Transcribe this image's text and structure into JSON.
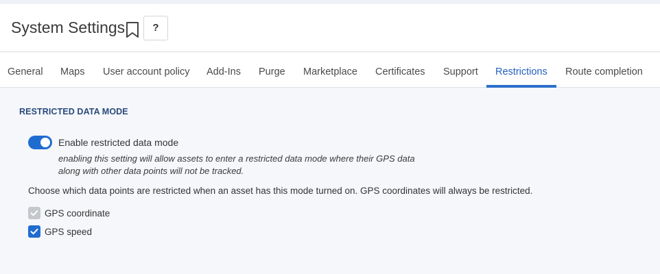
{
  "page": {
    "title": "System Settings",
    "help_label": "?"
  },
  "tabs": [
    {
      "label": "General",
      "active": false
    },
    {
      "label": "Maps",
      "active": false
    },
    {
      "label": "User account policy",
      "active": false
    },
    {
      "label": "Add-Ins",
      "active": false
    },
    {
      "label": "Purge",
      "active": false
    },
    {
      "label": "Marketplace",
      "active": false
    },
    {
      "label": "Certificates",
      "active": false
    },
    {
      "label": "Support",
      "active": false
    },
    {
      "label": "Restrictions",
      "active": true
    },
    {
      "label": "Route completion",
      "active": false
    }
  ],
  "section": {
    "title": "RESTRICTED DATA MODE",
    "toggle": {
      "label": "Enable restricted data mode",
      "on": true
    },
    "description": "enabling this setting will allow assets to enter a restricted data mode where their GPS data along with other data points will not be tracked.",
    "choose_text": "Choose which data points are restricted when an asset has this mode turned on. GPS coordinates will always be restricted.",
    "options": [
      {
        "label": "GPS coordinate",
        "checked": true,
        "disabled": true
      },
      {
        "label": "GPS speed",
        "checked": true,
        "disabled": false
      }
    ]
  },
  "colors": {
    "accent": "#1f6cd1",
    "active_tab": "#2460c0",
    "section_title": "#2a4a7c"
  }
}
